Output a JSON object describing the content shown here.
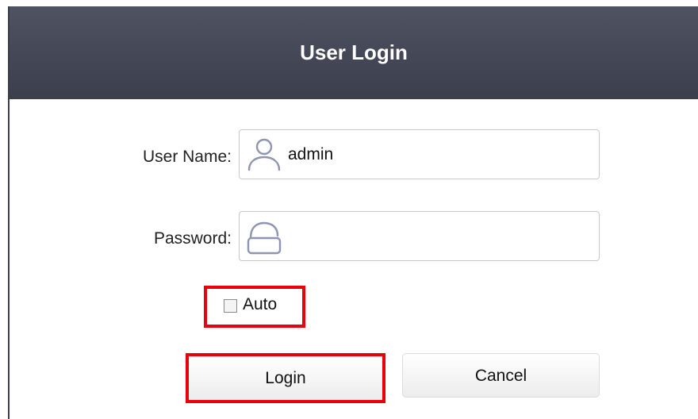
{
  "dialog": {
    "title": "User Login"
  },
  "form": {
    "username_label": "User Name:",
    "username_value": "admin",
    "password_label": "Password:",
    "password_value": "",
    "auto_label": "Auto",
    "auto_checked": false
  },
  "buttons": {
    "login_label": "Login",
    "cancel_label": "Cancel"
  },
  "icons": {
    "username": "user-icon",
    "password": "lock-icon"
  },
  "colors": {
    "titlebar": "#42455a",
    "highlight": "#e8000b",
    "icon_stroke": "#8e95b2"
  }
}
